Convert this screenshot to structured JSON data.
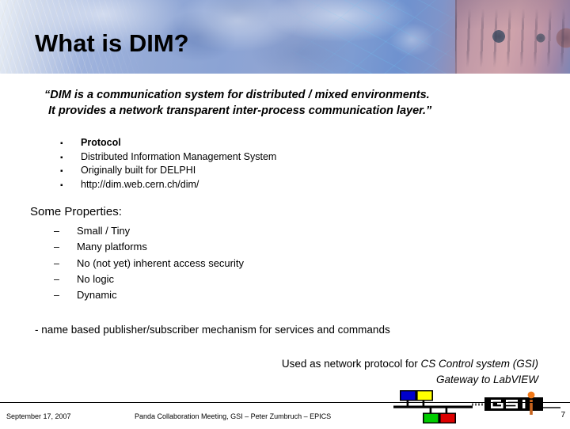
{
  "slide": {
    "title": "What is DIM?",
    "page_number": "7"
  },
  "quote": {
    "line1": "“DIM is a communication system for distributed / mixed environments.",
    "line2": "It provides a network transparent inter-process communication layer.”"
  },
  "bullets": {
    "marker": "▪",
    "items": [
      {
        "text": "Protocol",
        "bold": true
      },
      {
        "text": "Distributed Information Management System",
        "bold": false
      },
      {
        "text": "Originally built for DELPHI",
        "bold": false
      },
      {
        "text": "http://dim.web.cern.ch/dim/",
        "bold": false
      }
    ]
  },
  "properties": {
    "heading": "Some Properties:",
    "marker": "–",
    "items": [
      "Small / Tiny",
      "Many platforms",
      "No (not yet) inherent access security",
      "No logic",
      "Dynamic"
    ]
  },
  "tagline": "- name based publisher/subscriber mechanism for services and commands",
  "usage": {
    "line1_plain": "Used as network protocol for ",
    "line1_italic": "CS Control system (GSI)",
    "line2_italic": "Gateway to LabVIEW"
  },
  "footer": {
    "date": "September 17, 2007",
    "center": "Panda Collaboration Meeting, GSI – Peter Zumbruch –  EPICS"
  },
  "logos": {
    "cs_logo_name": "cs-control-system-logo",
    "gsi_wordmark": "GSI",
    "colors": {
      "square_blue": "#0000cc",
      "square_yellow": "#ffff00",
      "square_green": "#00cc00",
      "square_red": "#dd0000",
      "gsi_black": "#000000",
      "gsi_orange": "#f07818"
    }
  }
}
